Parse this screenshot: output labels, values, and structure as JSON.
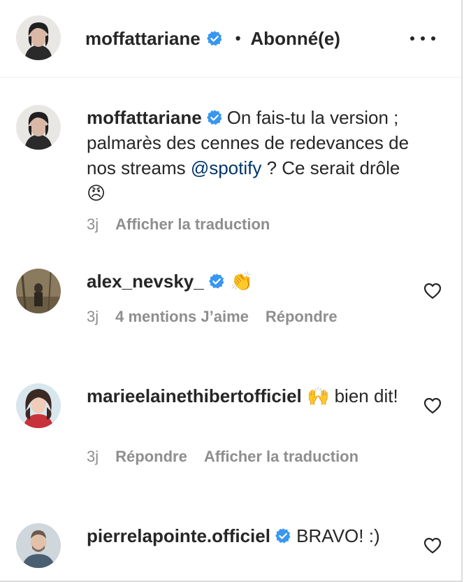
{
  "header": {
    "username": "moffattariane",
    "separator": "•",
    "follow_status": "Abonné(e)"
  },
  "comments": [
    {
      "username": "moffattariane",
      "text_before": "On fais-tu la version ; palmarès des cennes de redevances de nos streams ",
      "mention": "@spotify",
      "text_after": " ? Ce serait drôle ",
      "emoji": "😠",
      "time": "3j",
      "actions": [
        "Afficher la traduction"
      ]
    },
    {
      "username": "alex_nevsky_",
      "text": "",
      "emoji": "👏",
      "time": "3j",
      "actions": [
        "4 mentions J’aime",
        "Répondre"
      ]
    },
    {
      "username": "marieelainethibertofficiel",
      "emoji": "🙌",
      "text": " bien dit!",
      "time": "3j",
      "actions": [
        "Répondre",
        "Afficher la traduction"
      ]
    },
    {
      "username": "pierrelapointe.officiel",
      "text": " BRAVO! :)",
      "time": "",
      "actions": []
    }
  ],
  "colors": {
    "verified": "#3897f0",
    "mention": "#00376b",
    "meta": "#8e8e8e",
    "text": "#262626"
  },
  "icons": [
    "verified-badge-icon",
    "heart-icon",
    "more-options-icon"
  ]
}
